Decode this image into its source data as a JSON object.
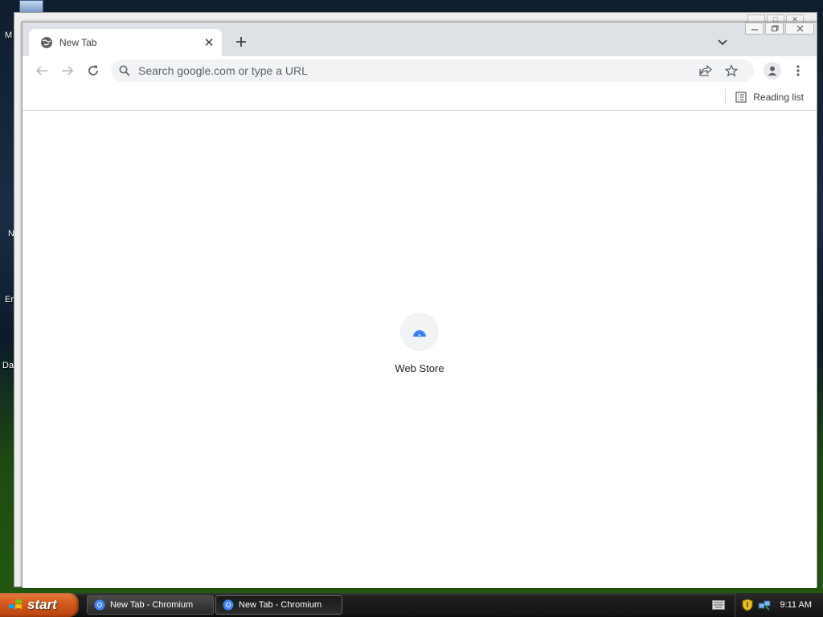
{
  "desktop": {
    "icon_labels": [
      "M",
      "N",
      "Er",
      "Da"
    ]
  },
  "browser": {
    "tab": {
      "title": "New Tab",
      "close_symbol": "✕",
      "favicon": "globe-icon"
    },
    "new_tab_symbol": "+",
    "omnibox": {
      "placeholder": "Search google.com or type a URL",
      "value": ""
    },
    "bookmarks_bar": {
      "reading_list_label": "Reading list"
    },
    "content": {
      "shortcuts": [
        {
          "label": "Web Store",
          "icon": "web-store-icon"
        }
      ]
    },
    "colors": {
      "titlebar": "#dee1e6",
      "omnibox_bg": "#f1f3f4",
      "accent_blue": "#4285f4"
    }
  },
  "taskbar": {
    "start_label": "start",
    "tasks": [
      {
        "label": "New Tab - Chromium",
        "active": false
      },
      {
        "label": "New Tab - Chromium",
        "active": true
      }
    ],
    "clock": "9:11 AM"
  }
}
